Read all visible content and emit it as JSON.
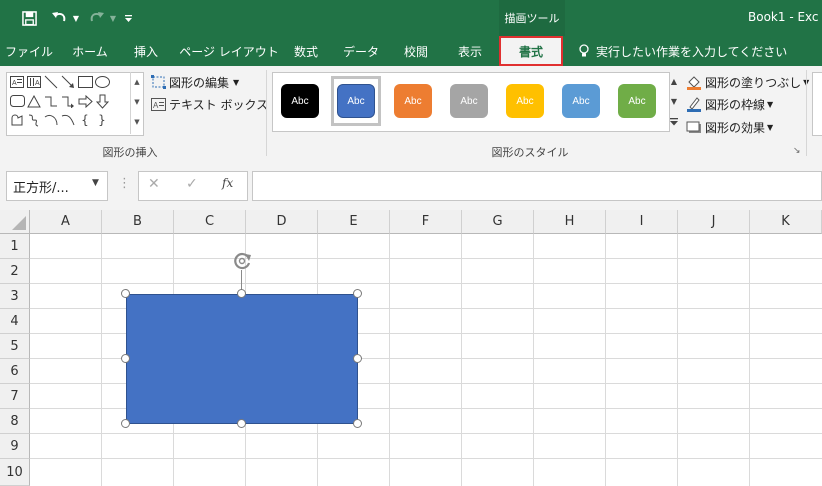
{
  "title_bar": {
    "app_title": "Book1 - Exc",
    "context_group": "描画ツール",
    "quick_access": {
      "save_icon": "save-icon",
      "undo_icon": "undo-icon",
      "redo_icon": "redo-icon",
      "customize_icon": "customize-qat-icon"
    }
  },
  "tabs": [
    {
      "label": "ファイル"
    },
    {
      "label": "ホーム"
    },
    {
      "label": "挿入"
    },
    {
      "label": "ページ レイアウト"
    },
    {
      "label": "数式"
    },
    {
      "label": "データ"
    },
    {
      "label": "校閲"
    },
    {
      "label": "表示"
    },
    {
      "label": "書式",
      "active": true
    }
  ],
  "tell_me": "実行したい作業を入力してください",
  "ribbon": {
    "insert_shapes": {
      "label": "図形の挿入",
      "edit_shape": "図形の編集",
      "text_box": "テキスト ボックス"
    },
    "shape_styles": {
      "label": "図形のスタイル",
      "swatch_text": "Abc",
      "swatches": [
        {
          "color": "#000000"
        },
        {
          "color": "#4472c4",
          "selected": true
        },
        {
          "color": "#ed7d31"
        },
        {
          "color": "#a5a5a5"
        },
        {
          "color": "#ffc000"
        },
        {
          "color": "#5b9bd5"
        },
        {
          "color": "#70ad47"
        }
      ],
      "fill": "図形の塗りつぶし",
      "outline": "図形の枠線",
      "effects": "図形の効果"
    }
  },
  "formula_bar": {
    "name_box": "正方形/...",
    "cancel_icon": "✕",
    "enter_icon": "✓",
    "fx_icon": "fx",
    "formula": ""
  },
  "grid": {
    "columns": [
      "A",
      "B",
      "C",
      "D",
      "E",
      "F",
      "G",
      "H",
      "I",
      "J",
      "K"
    ],
    "rows": [
      "1",
      "2",
      "3",
      "4",
      "5",
      "6",
      "7",
      "8",
      "9",
      "10"
    ]
  },
  "shape": {
    "fill": "#4472c4",
    "outline": "#2f528f",
    "rotate_icon": "rotate-handle-icon"
  },
  "colors": {
    "excel_green": "#217346",
    "highlight_red": "#e03030"
  }
}
